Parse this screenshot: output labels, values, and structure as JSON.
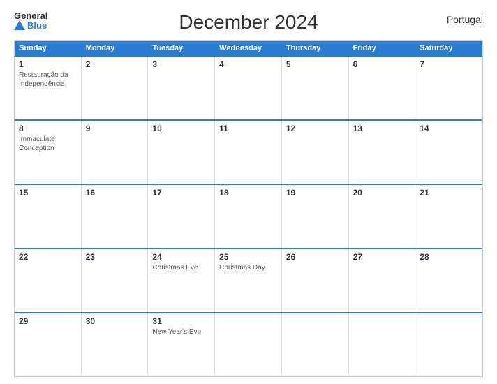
{
  "header": {
    "title": "December 2024",
    "country": "Portugal",
    "logo_general": "General",
    "logo_blue": "Blue"
  },
  "days_of_week": [
    "Sunday",
    "Monday",
    "Tuesday",
    "Wednesday",
    "Thursday",
    "Friday",
    "Saturday"
  ],
  "weeks": [
    [
      {
        "num": "1",
        "events": [
          "Restauração da",
          "Independência"
        ]
      },
      {
        "num": "2",
        "events": []
      },
      {
        "num": "3",
        "events": []
      },
      {
        "num": "4",
        "events": []
      },
      {
        "num": "5",
        "events": []
      },
      {
        "num": "6",
        "events": []
      },
      {
        "num": "7",
        "events": []
      }
    ],
    [
      {
        "num": "8",
        "events": [
          "Immaculate",
          "Conception"
        ]
      },
      {
        "num": "9",
        "events": []
      },
      {
        "num": "10",
        "events": []
      },
      {
        "num": "11",
        "events": []
      },
      {
        "num": "12",
        "events": []
      },
      {
        "num": "13",
        "events": []
      },
      {
        "num": "14",
        "events": []
      }
    ],
    [
      {
        "num": "15",
        "events": []
      },
      {
        "num": "16",
        "events": []
      },
      {
        "num": "17",
        "events": []
      },
      {
        "num": "18",
        "events": []
      },
      {
        "num": "19",
        "events": []
      },
      {
        "num": "20",
        "events": []
      },
      {
        "num": "21",
        "events": []
      }
    ],
    [
      {
        "num": "22",
        "events": []
      },
      {
        "num": "23",
        "events": []
      },
      {
        "num": "24",
        "events": [
          "Christmas Eve"
        ]
      },
      {
        "num": "25",
        "events": [
          "Christmas Day"
        ]
      },
      {
        "num": "26",
        "events": []
      },
      {
        "num": "27",
        "events": []
      },
      {
        "num": "28",
        "events": []
      }
    ],
    [
      {
        "num": "29",
        "events": []
      },
      {
        "num": "30",
        "events": []
      },
      {
        "num": "31",
        "events": [
          "New Year's Eve"
        ]
      },
      {
        "num": "",
        "events": []
      },
      {
        "num": "",
        "events": []
      },
      {
        "num": "",
        "events": []
      },
      {
        "num": "",
        "events": []
      }
    ]
  ]
}
